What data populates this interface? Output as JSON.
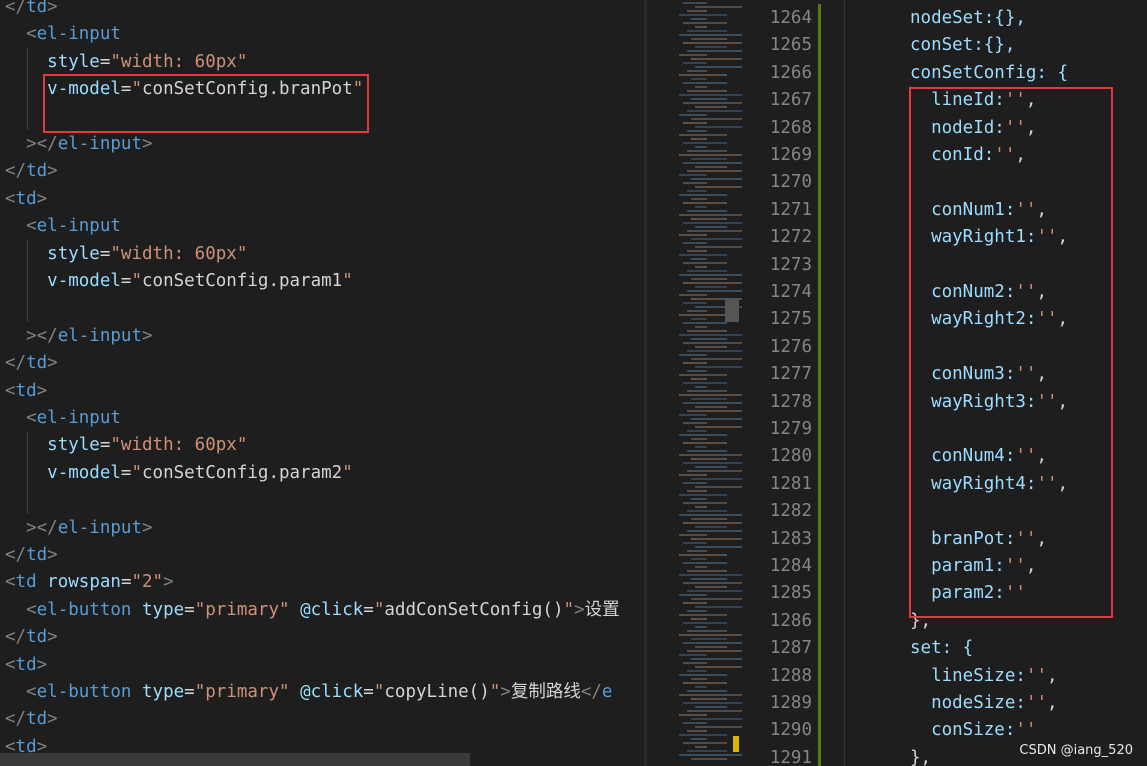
{
  "left_editor": {
    "lines": [
      [
        {
          "t": "</",
          "c": "punc"
        },
        {
          "t": "td",
          "c": "tag"
        },
        {
          "t": ">",
          "c": "punc"
        }
      ],
      [
        {
          "t": "  "
        },
        {
          "t": "<",
          "c": "punc"
        },
        {
          "t": "el-input",
          "c": "tag"
        }
      ],
      [
        {
          "t": "    "
        },
        {
          "t": "style",
          "c": "attr"
        },
        {
          "t": "=",
          "c": "plain"
        },
        {
          "t": "\"width: 60px\"",
          "c": "str"
        }
      ],
      [
        {
          "t": "    "
        },
        {
          "t": "v-model",
          "c": "attr"
        },
        {
          "t": "=",
          "c": "plain"
        },
        {
          "t": "\"",
          "c": "str"
        },
        {
          "t": "conSetConfig.branPot",
          "c": "plain"
        },
        {
          "t": "\"",
          "c": "str"
        }
      ],
      [
        {
          "t": ""
        }
      ],
      [
        {
          "t": "  "
        },
        {
          "t": "></",
          "c": "punc"
        },
        {
          "t": "el-input",
          "c": "tag"
        },
        {
          "t": ">",
          "c": "punc"
        }
      ],
      [
        {
          "t": "</",
          "c": "punc"
        },
        {
          "t": "td",
          "c": "tag"
        },
        {
          "t": ">",
          "c": "punc"
        }
      ],
      [
        {
          "t": "<",
          "c": "punc"
        },
        {
          "t": "td",
          "c": "tag"
        },
        {
          "t": ">",
          "c": "punc"
        }
      ],
      [
        {
          "t": "  "
        },
        {
          "t": "<",
          "c": "punc"
        },
        {
          "t": "el-input",
          "c": "tag"
        }
      ],
      [
        {
          "t": "    "
        },
        {
          "t": "style",
          "c": "attr"
        },
        {
          "t": "=",
          "c": "plain"
        },
        {
          "t": "\"width: 60px\"",
          "c": "str"
        }
      ],
      [
        {
          "t": "    "
        },
        {
          "t": "v-model",
          "c": "attr"
        },
        {
          "t": "=",
          "c": "plain"
        },
        {
          "t": "\"",
          "c": "str"
        },
        {
          "t": "conSetConfig.param1",
          "c": "plain"
        },
        {
          "t": "\"",
          "c": "str"
        }
      ],
      [
        {
          "t": ""
        }
      ],
      [
        {
          "t": "  "
        },
        {
          "t": "></",
          "c": "punc"
        },
        {
          "t": "el-input",
          "c": "tag"
        },
        {
          "t": ">",
          "c": "punc"
        }
      ],
      [
        {
          "t": "</",
          "c": "punc"
        },
        {
          "t": "td",
          "c": "tag"
        },
        {
          "t": ">",
          "c": "punc"
        }
      ],
      [
        {
          "t": "<",
          "c": "punc"
        },
        {
          "t": "td",
          "c": "tag"
        },
        {
          "t": ">",
          "c": "punc"
        }
      ],
      [
        {
          "t": "  "
        },
        {
          "t": "<",
          "c": "punc"
        },
        {
          "t": "el-input",
          "c": "tag"
        }
      ],
      [
        {
          "t": "    "
        },
        {
          "t": "style",
          "c": "attr"
        },
        {
          "t": "=",
          "c": "plain"
        },
        {
          "t": "\"width: 60px\"",
          "c": "str"
        }
      ],
      [
        {
          "t": "    "
        },
        {
          "t": "v-model",
          "c": "attr"
        },
        {
          "t": "=",
          "c": "plain"
        },
        {
          "t": "\"",
          "c": "str"
        },
        {
          "t": "conSetConfig.param2",
          "c": "plain"
        },
        {
          "t": "\"",
          "c": "str"
        }
      ],
      [
        {
          "t": ""
        }
      ],
      [
        {
          "t": "  "
        },
        {
          "t": "></",
          "c": "punc"
        },
        {
          "t": "el-input",
          "c": "tag"
        },
        {
          "t": ">",
          "c": "punc"
        }
      ],
      [
        {
          "t": "</",
          "c": "punc"
        },
        {
          "t": "td",
          "c": "tag"
        },
        {
          "t": ">",
          "c": "punc"
        }
      ],
      [
        {
          "t": "<",
          "c": "punc"
        },
        {
          "t": "td",
          "c": "tag"
        },
        {
          "t": " "
        },
        {
          "t": "rowspan",
          "c": "attr"
        },
        {
          "t": "=",
          "c": "plain"
        },
        {
          "t": "\"2\"",
          "c": "str"
        },
        {
          "t": ">",
          "c": "punc"
        }
      ],
      [
        {
          "t": "  "
        },
        {
          "t": "<",
          "c": "punc"
        },
        {
          "t": "el-button",
          "c": "tag"
        },
        {
          "t": " "
        },
        {
          "t": "type",
          "c": "attr"
        },
        {
          "t": "=",
          "c": "plain"
        },
        {
          "t": "\"primary\"",
          "c": "str"
        },
        {
          "t": " "
        },
        {
          "t": "@click",
          "c": "attr"
        },
        {
          "t": "=",
          "c": "plain"
        },
        {
          "t": "\"",
          "c": "str"
        },
        {
          "t": "addConSetConfig()",
          "c": "plain"
        },
        {
          "t": "\"",
          "c": "str"
        },
        {
          "t": ">",
          "c": "punc"
        },
        {
          "t": "设置",
          "c": "plain"
        }
      ],
      [
        {
          "t": "</",
          "c": "punc"
        },
        {
          "t": "td",
          "c": "tag"
        },
        {
          "t": ">",
          "c": "punc"
        }
      ],
      [
        {
          "t": "<",
          "c": "punc"
        },
        {
          "t": "td",
          "c": "tag"
        },
        {
          "t": ">",
          "c": "punc"
        }
      ],
      [
        {
          "t": "  "
        },
        {
          "t": "<",
          "c": "punc"
        },
        {
          "t": "el-button",
          "c": "tag"
        },
        {
          "t": " "
        },
        {
          "t": "type",
          "c": "attr"
        },
        {
          "t": "=",
          "c": "plain"
        },
        {
          "t": "\"primary\"",
          "c": "str"
        },
        {
          "t": " "
        },
        {
          "t": "@click",
          "c": "attr"
        },
        {
          "t": "=",
          "c": "plain"
        },
        {
          "t": "\"",
          "c": "str"
        },
        {
          "t": "copyLine()",
          "c": "plain"
        },
        {
          "t": "\"",
          "c": "str"
        },
        {
          "t": ">",
          "c": "punc"
        },
        {
          "t": "复制路线",
          "c": "plain"
        },
        {
          "t": "</",
          "c": "punc"
        },
        {
          "t": "e",
          "c": "tag"
        }
      ],
      [
        {
          "t": "</",
          "c": "punc"
        },
        {
          "t": "td",
          "c": "tag"
        },
        {
          "t": ">",
          "c": "punc"
        }
      ],
      [
        {
          "t": "<",
          "c": "punc"
        },
        {
          "t": "td",
          "c": "tag"
        },
        {
          "t": ">",
          "c": "punc"
        }
      ]
    ]
  },
  "right_editor": {
    "line_numbers": [
      "1264",
      "1265",
      "1266",
      "1267",
      "1268",
      "1269",
      "1270",
      "1271",
      "1272",
      "1273",
      "1274",
      "1275",
      "1276",
      "1277",
      "1278",
      "1279",
      "1280",
      "1281",
      "1282",
      "1283",
      "1284",
      "1285",
      "1286",
      "1287",
      "1288",
      "1289",
      "1290",
      "1291"
    ],
    "lines": [
      [
        {
          "t": "nodeSet:{},",
          "c": "attr"
        }
      ],
      [
        {
          "t": "conSet:{},",
          "c": "attr"
        }
      ],
      [
        {
          "t": "conSetConfig: {",
          "c": "attr"
        }
      ],
      [
        {
          "t": "  lineId:",
          "c": "attr"
        },
        {
          "t": "''",
          "c": "str"
        },
        {
          "t": ",",
          "c": "plain"
        }
      ],
      [
        {
          "t": "  nodeId:",
          "c": "attr"
        },
        {
          "t": "''",
          "c": "str"
        },
        {
          "t": ",",
          "c": "plain"
        }
      ],
      [
        {
          "t": "  conId:",
          "c": "attr"
        },
        {
          "t": "''",
          "c": "str"
        },
        {
          "t": ",",
          "c": "plain"
        }
      ],
      [
        {
          "t": ""
        }
      ],
      [
        {
          "t": "  conNum1:",
          "c": "attr"
        },
        {
          "t": "''",
          "c": "str"
        },
        {
          "t": ",",
          "c": "plain"
        }
      ],
      [
        {
          "t": "  wayRight1:",
          "c": "attr"
        },
        {
          "t": "''",
          "c": "str"
        },
        {
          "t": ",",
          "c": "plain"
        }
      ],
      [
        {
          "t": ""
        }
      ],
      [
        {
          "t": "  conNum2:",
          "c": "attr"
        },
        {
          "t": "''",
          "c": "str"
        },
        {
          "t": ",",
          "c": "plain"
        }
      ],
      [
        {
          "t": "  wayRight2:",
          "c": "attr"
        },
        {
          "t": "''",
          "c": "str"
        },
        {
          "t": ",",
          "c": "plain"
        }
      ],
      [
        {
          "t": ""
        }
      ],
      [
        {
          "t": "  conNum3:",
          "c": "attr"
        },
        {
          "t": "''",
          "c": "str"
        },
        {
          "t": ",",
          "c": "plain"
        }
      ],
      [
        {
          "t": "  wayRight3:",
          "c": "attr"
        },
        {
          "t": "''",
          "c": "str"
        },
        {
          "t": ",",
          "c": "plain"
        }
      ],
      [
        {
          "t": ""
        }
      ],
      [
        {
          "t": "  conNum4:",
          "c": "attr"
        },
        {
          "t": "''",
          "c": "str"
        },
        {
          "t": ",",
          "c": "plain"
        }
      ],
      [
        {
          "t": "  wayRight4:",
          "c": "attr"
        },
        {
          "t": "''",
          "c": "str"
        },
        {
          "t": ",",
          "c": "plain"
        }
      ],
      [
        {
          "t": ""
        }
      ],
      [
        {
          "t": "  branPot:",
          "c": "attr"
        },
        {
          "t": "''",
          "c": "str"
        },
        {
          "t": ",",
          "c": "plain"
        }
      ],
      [
        {
          "t": "  param1:",
          "c": "attr"
        },
        {
          "t": "''",
          "c": "str"
        },
        {
          "t": ",",
          "c": "plain"
        }
      ],
      [
        {
          "t": "  param2:",
          "c": "attr"
        },
        {
          "t": "''",
          "c": "str"
        }
      ],
      [
        {
          "t": "},",
          "c": "plain"
        }
      ],
      [
        {
          "t": "set: {",
          "c": "attr"
        }
      ],
      [
        {
          "t": "  lineSize:",
          "c": "attr"
        },
        {
          "t": "''",
          "c": "str"
        },
        {
          "t": ",",
          "c": "plain"
        }
      ],
      [
        {
          "t": "  nodeSize:",
          "c": "attr"
        },
        {
          "t": "''",
          "c": "str"
        },
        {
          "t": ",",
          "c": "plain"
        }
      ],
      [
        {
          "t": "  conSize:",
          "c": "attr"
        },
        {
          "t": "''",
          "c": "str"
        }
      ],
      [
        {
          "t": "},",
          "c": "plain"
        }
      ]
    ]
  },
  "watermark": "CSDN @iang_520",
  "colors": {
    "background": "#1e1e1e",
    "tag": "#569cd6",
    "attribute": "#9cdcfe",
    "string": "#ce9178",
    "highlight_box": "#e0393e"
  }
}
